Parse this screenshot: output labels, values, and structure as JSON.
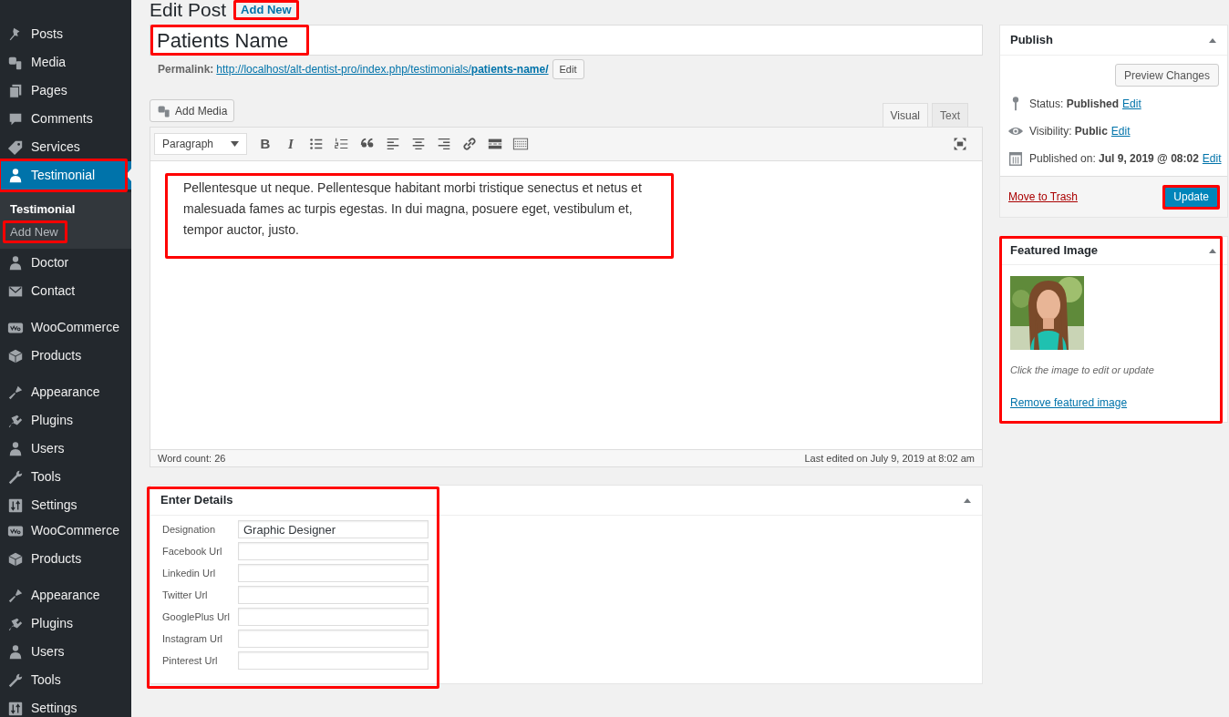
{
  "sidebar": {
    "groups": [
      [
        {
          "label": "Posts",
          "selected": false,
          "highlighted": false
        },
        {
          "label": "Media",
          "selected": false,
          "highlighted": false
        },
        {
          "label": "Pages",
          "selected": false,
          "highlighted": false
        },
        {
          "label": "Comments",
          "selected": false,
          "highlighted": false
        },
        {
          "label": "Services",
          "selected": false,
          "highlighted": false
        },
        {
          "label": "Testimonial",
          "selected": true,
          "highlighted": true,
          "submenu": [
            {
              "label": "Testimonial",
              "selected": true,
              "highlighted": false
            },
            {
              "label": "Add New",
              "selected": false,
              "highlighted": true
            }
          ]
        },
        {
          "label": "Doctor",
          "selected": false,
          "highlighted": false
        },
        {
          "label": "Contact",
          "selected": false,
          "highlighted": false
        }
      ],
      [
        {
          "label": "WooCommerce",
          "selected": false,
          "highlighted": false
        },
        {
          "label": "Products",
          "selected": false,
          "highlighted": false
        }
      ],
      [
        {
          "label": "Appearance",
          "selected": false,
          "highlighted": false
        },
        {
          "label": "Plugins",
          "selected": false,
          "highlighted": false
        },
        {
          "label": "Users",
          "selected": false,
          "highlighted": false
        },
        {
          "label": "Tools",
          "selected": false,
          "highlighted": false
        },
        {
          "label": "Settings",
          "selected": false,
          "highlighted": false
        }
      ],
      [
        {
          "label": "WooCommerce",
          "selected": false,
          "highlighted": false
        },
        {
          "label": "Products",
          "selected": false,
          "highlighted": false
        }
      ],
      [
        {
          "label": "Appearance",
          "selected": false,
          "highlighted": false
        },
        {
          "label": "Plugins",
          "selected": false,
          "highlighted": false
        },
        {
          "label": "Users",
          "selected": false,
          "highlighted": false
        },
        {
          "label": "Tools",
          "selected": false,
          "highlighted": false
        },
        {
          "label": "Settings",
          "selected": false,
          "highlighted": false
        }
      ]
    ]
  },
  "header": {
    "title": "Edit Post",
    "add_new": {
      "label": "Add New",
      "highlighted": true
    }
  },
  "post_title": {
    "value": "Patients Name",
    "highlighted": true
  },
  "permalink": {
    "label": "Permalink:",
    "link": "http://localhost/alt-dentist-pro/index.php/testimonials/**patients-name/**",
    "edit": "Edit"
  },
  "editor": {
    "add_media": "Add Media",
    "tabs": [
      {
        "label": "Visual",
        "selected": true
      },
      {
        "label": "Text",
        "selected": false
      }
    ],
    "toolbar": {
      "format": "Paragraph",
      "bold": "B",
      "italic": "I"
    },
    "content": {
      "text": "Pellentesque ut neque. Pellentesque habitant morbi tristique senectus et netus et malesuada fames ac turpis egestas. In dui magna, posuere eget, vestibulum et, tempor auctor, justo.",
      "highlighted": true
    },
    "word_count": "Word count: 26",
    "last_edited": "Last edited on July 9, 2019 at 8:02 am"
  },
  "details": {
    "title": "Enter Details",
    "highlighted": true,
    "fields": [
      {
        "label": "Designation",
        "value": "Graphic Designer"
      },
      {
        "label": "Facebook Url"
      },
      {
        "label": "Linkedin Url"
      },
      {
        "label": "Twitter Url"
      },
      {
        "label": "GooglePlus Url"
      },
      {
        "label": "Instagram Url"
      },
      {
        "label": "Pinterest Url"
      }
    ]
  },
  "publish": {
    "title": "Publish",
    "preview": "Preview Changes",
    "rows": [
      {
        "text": "Status: **Published**",
        "edit": "Edit"
      },
      {
        "text": "Visibility: **Public**",
        "edit": "Edit"
      },
      {
        "text": "Published on: **Jul 9, 2019 @ 08:02**",
        "edit": "Edit"
      }
    ],
    "trash": "Move to Trash",
    "update": {
      "label": "Update",
      "highlighted": true
    }
  },
  "featured": {
    "title": "Featured Image",
    "highlighted": true,
    "caption": "Click the image to edit or update",
    "remove": "Remove featured image"
  }
}
